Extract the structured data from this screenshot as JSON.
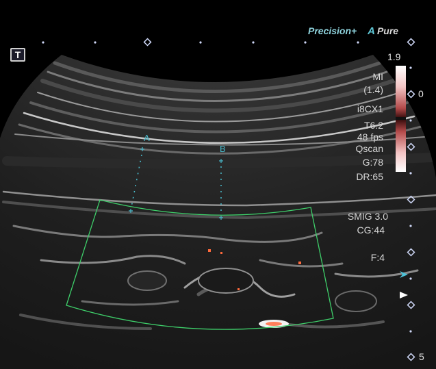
{
  "brand": {
    "precision": "Precision",
    "plus": "+",
    "a": "A",
    "pure": "Pure"
  },
  "t_marker": "T",
  "depth_scale": {
    "top_value": "1.9",
    "mid_value": "0",
    "bottom_value": "5"
  },
  "params": {
    "mi": "MI",
    "mi_value": "(1.4)",
    "probe": "i8CX1",
    "tis": "T6.2",
    "fps": "48 fps",
    "qscan": "Qscan",
    "gain": "G:78",
    "dynamic_range": "DR:65",
    "smig": "SMIG 3.0",
    "color_gain": "CG:44",
    "focus": "F:4"
  },
  "calipers": {
    "a_label": "A",
    "b_label": "B"
  },
  "colors": {
    "brand": "#8fd3dd",
    "caliper": "#49b8c9",
    "roi": "#3ecf6a",
    "flow": "#ff6a3c"
  }
}
